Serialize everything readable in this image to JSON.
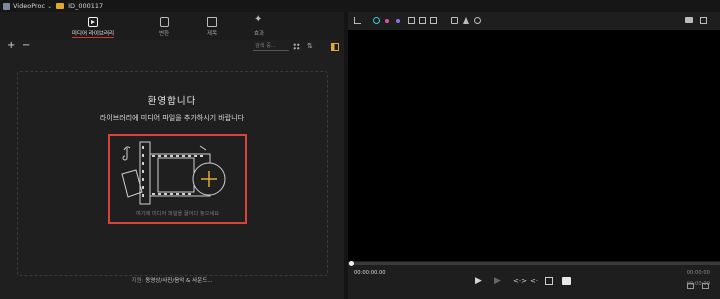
{
  "titlebar": {
    "app_name": "VideoProc",
    "project_name": "ID_000117"
  },
  "tabs": [
    {
      "label": "미디어 라이브러리",
      "icon": "media-library-icon",
      "active": true
    },
    {
      "label": "변환",
      "icon": "transition-icon",
      "active": false
    },
    {
      "label": "제목",
      "icon": "title-icon",
      "active": false
    },
    {
      "label": "효과",
      "icon": "effects-icon",
      "active": false
    }
  ],
  "library": {
    "add_label": "+",
    "remove_label": "−",
    "search_placeholder": "검색 중...",
    "welcome_title": "환영합니다",
    "welcome_subtitle": "라이브러리에 미디어 파일을 추가하시기 바랍니다",
    "drop_hint": "여기에 미디어 파일을 끌어다 놓으세요",
    "supported_label": "지원:",
    "supported_formats": "동영상/사진/음악 & 사운드..."
  },
  "player": {
    "current_time": "00:00:00.00",
    "duration": "00:00:00",
    "duration2": "00:00:00",
    "progress": 0
  },
  "colors": {
    "accent_red": "#d8433a",
    "accent_orange": "#e0a93a",
    "gizmo_cyan": "#37c7d6",
    "gizmo_pink": "#e24fa1",
    "gizmo_purple": "#8c6ff0"
  }
}
